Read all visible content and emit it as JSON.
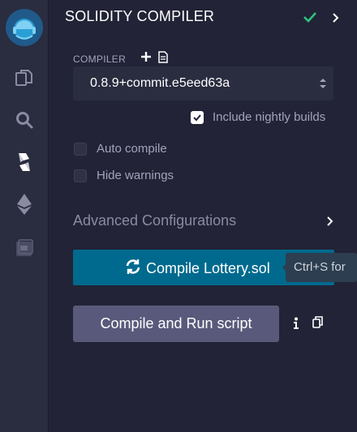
{
  "panel": {
    "title": "SOLIDITY COMPILER"
  },
  "compiler": {
    "label": "COMPILER",
    "selected_version": "0.8.9+commit.e5eed63a"
  },
  "options": {
    "include_nightly": {
      "label": "Include nightly builds",
      "checked": true
    },
    "auto_compile": {
      "label": "Auto compile",
      "checked": false
    },
    "hide_warnings": {
      "label": "Hide warnings",
      "checked": false
    }
  },
  "advanced": {
    "label": "Advanced Configurations"
  },
  "actions": {
    "compile_label": "Compile Lottery.sol",
    "compile_tooltip": "Ctrl+S for",
    "run_script_label": "Compile and Run script"
  },
  "colors": {
    "background": "#222336",
    "iconbar": "#2a2c3f",
    "accent_blue": "#006a8e",
    "success_green": "#2ec27e",
    "secondary_button": "#595a7b"
  },
  "icons": {
    "sidebar": [
      "remix-logo-icon",
      "file-explorer-icon",
      "search-icon",
      "solidity-compiler-icon",
      "deploy-run-icon",
      "plugin-icon"
    ]
  }
}
